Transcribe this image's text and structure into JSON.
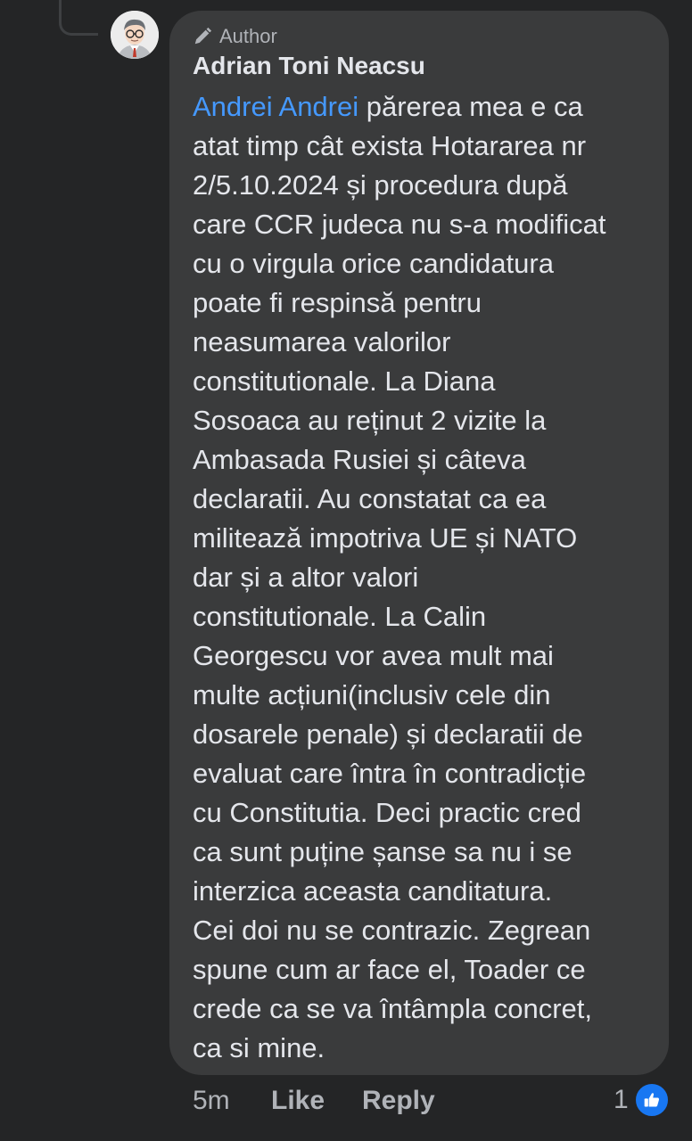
{
  "comment": {
    "badge": "Author",
    "author": "Adrian Toni Neacsu",
    "mention": "Andrei Andrei",
    "first_line_rest": " părerea mea e ca",
    "lines": [
      "atat timp cât exista Hotararea nr",
      "2/5.10.2024 și procedura după",
      "care CCR judeca nu s-a modificat",
      "cu o virgula orice candidatura",
      "poate fi respinsă pentru",
      "neasumarea valorilor",
      "constitutionale. La Diana",
      "Sosoaca au reținut 2 vizite la",
      "Ambasada Rusiei și câteva",
      "declaratii. Au constatat ca ea",
      "militează impotriva UE și NATO",
      "dar și a altor valori",
      "constitutionale. La Calin",
      "Georgescu vor avea mult mai",
      "multe acțiuni(inclusiv cele din",
      "dosarele penale) și declaratii de",
      "evaluat care întra în contradicție",
      "cu Constitutia. Deci practic cred",
      "ca sunt puține șanse sa nu i se",
      "interzica aceasta canditatura.",
      "Cei doi nu se contrazic. Zegrean",
      "spune cum ar face el, Toader ce",
      "crede ca se va întâmpla concret,",
      "ca si mine."
    ],
    "time": "5m",
    "like_label": "Like",
    "reply_label": "Reply",
    "reaction_count": "1",
    "reaction_icon": "thumbs-up-icon",
    "colors": {
      "background": "#242526",
      "bubble": "#3a3b3c",
      "text": "#e4e6eb",
      "muted": "#b0b3b8",
      "mention": "#4599ff",
      "like_blue": "#1877f2"
    }
  }
}
